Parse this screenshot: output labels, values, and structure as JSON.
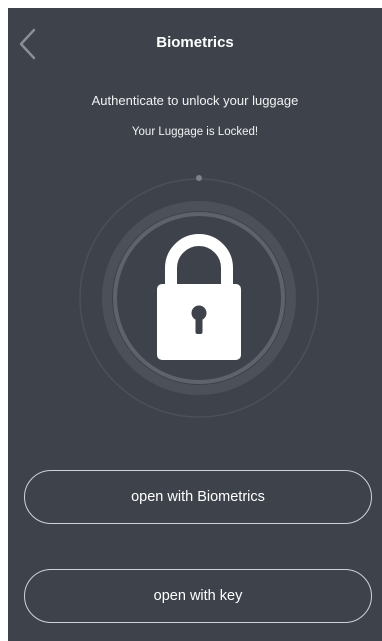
{
  "header": {
    "title": "Biometrics",
    "back_icon": "chevron-left-icon"
  },
  "prompt": {
    "instruction": "Authenticate to unlock your luggage",
    "status": "Your Luggage is Locked!"
  },
  "lock": {
    "icon": "padlock-icon",
    "state": "locked"
  },
  "actions": {
    "biometrics_label": "open with Biometrics",
    "key_label": "open with key"
  },
  "colors": {
    "background": "#3d424b",
    "ring_outer": "#4b5059",
    "ring_inner": "#5e636b",
    "foreground": "#ffffff",
    "button_border": "#cfd3d8"
  }
}
